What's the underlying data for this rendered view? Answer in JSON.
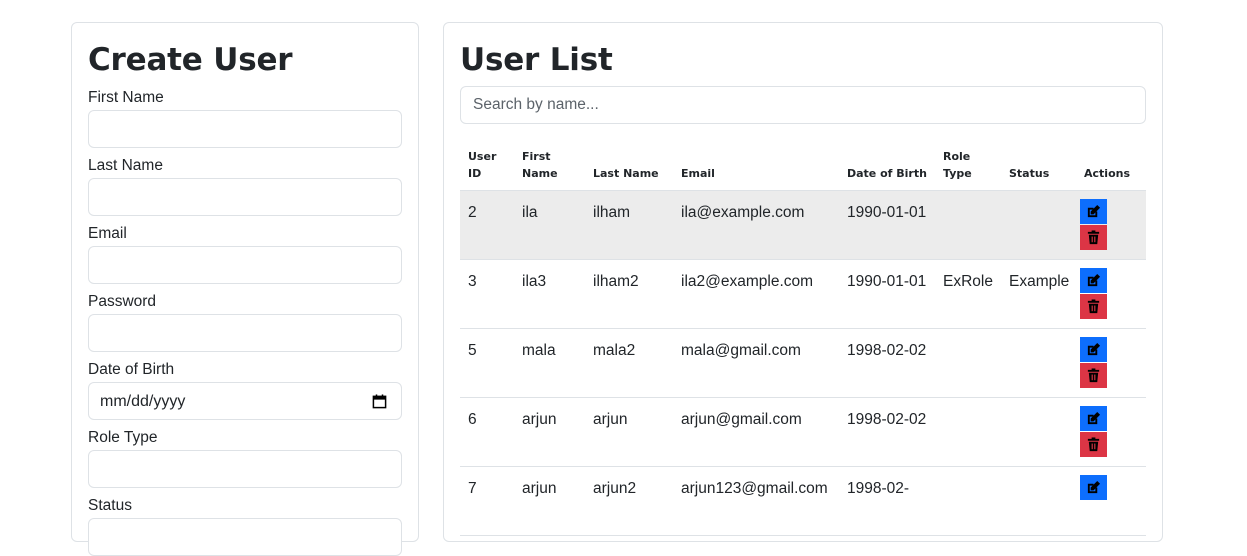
{
  "create": {
    "title": "Create User",
    "fields": [
      {
        "label": "First Name",
        "value": ""
      },
      {
        "label": "Last Name",
        "value": ""
      },
      {
        "label": "Email",
        "value": ""
      },
      {
        "label": "Password",
        "value": ""
      },
      {
        "label": "Date of Birth",
        "placeholder": "mm/dd/yyyy"
      },
      {
        "label": "Role Type",
        "value": ""
      },
      {
        "label": "Status",
        "value": ""
      }
    ]
  },
  "list": {
    "title": "User List",
    "search_placeholder": "Search by name...",
    "headers": [
      "User ID",
      "First Name",
      "Last Name",
      "Email",
      "Date of Birth",
      "Role Type",
      "Status",
      "Actions"
    ],
    "rows": [
      {
        "id": "2",
        "first": "ila",
        "last": "ilham",
        "email": "ila@example.com",
        "dob": "1990-01-01",
        "role": "",
        "status": ""
      },
      {
        "id": "3",
        "first": "ila3",
        "last": "ilham2",
        "email": "ila2@example.com",
        "dob": "1990-01-01",
        "role": "ExRole",
        "status": "Example"
      },
      {
        "id": "5",
        "first": "mala",
        "last": "mala2",
        "email": "mala@gmail.com",
        "dob": "1998-02-02",
        "role": "",
        "status": ""
      },
      {
        "id": "6",
        "first": "arjun",
        "last": "arjun",
        "email": "arjun@gmail.com",
        "dob": "1998-02-02",
        "role": "",
        "status": ""
      },
      {
        "id": "7",
        "first": "arjun",
        "last": "arjun2",
        "email": "arjun123@gmail.com",
        "dob": "1998-02-",
        "role": "",
        "status": ""
      }
    ]
  },
  "colors": {
    "edit": "#0d6efd",
    "delete": "#dc3545",
    "stripe": "#ececec",
    "border": "#dee2e6"
  },
  "icons": {
    "edit": "edit-icon",
    "delete": "trash-icon",
    "date": "calendar-icon"
  }
}
